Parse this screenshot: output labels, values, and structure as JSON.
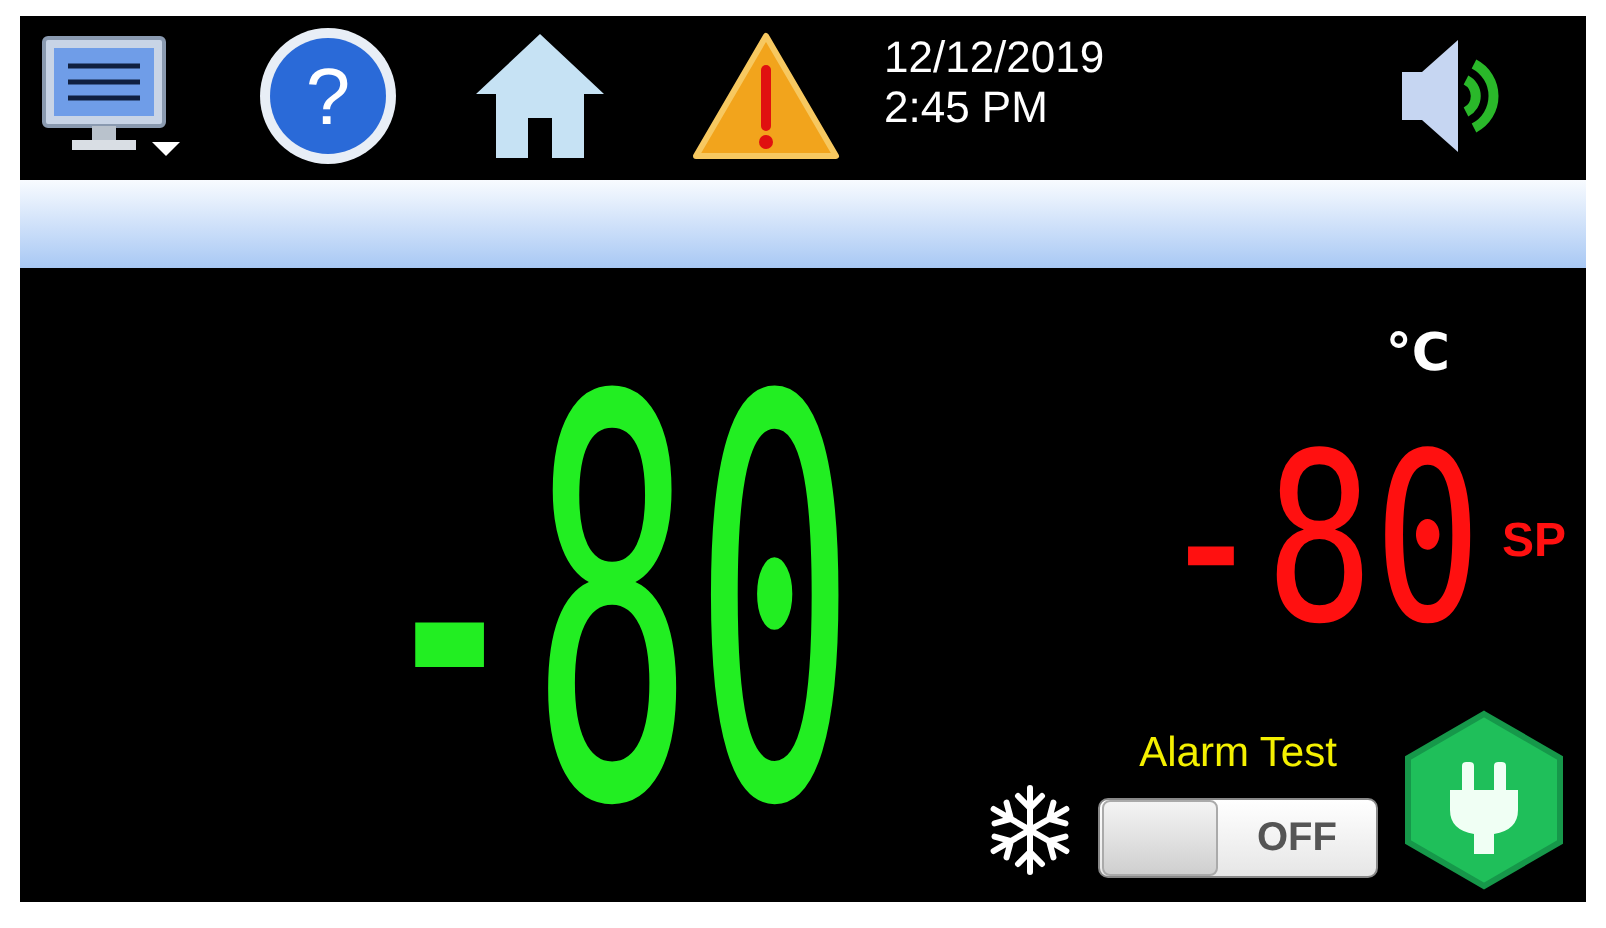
{
  "toolbar": {
    "help_icon": "?"
  },
  "status_bar": {
    "date": "12/12/2019",
    "time": "2:45 PM"
  },
  "process_value": {
    "value": "-80",
    "unit": "°C"
  },
  "setpoint": {
    "value": "-80",
    "label": "SP"
  },
  "alarm_test": {
    "label": "Alarm Test",
    "switch": {
      "on": false,
      "text": "OFF"
    }
  }
}
